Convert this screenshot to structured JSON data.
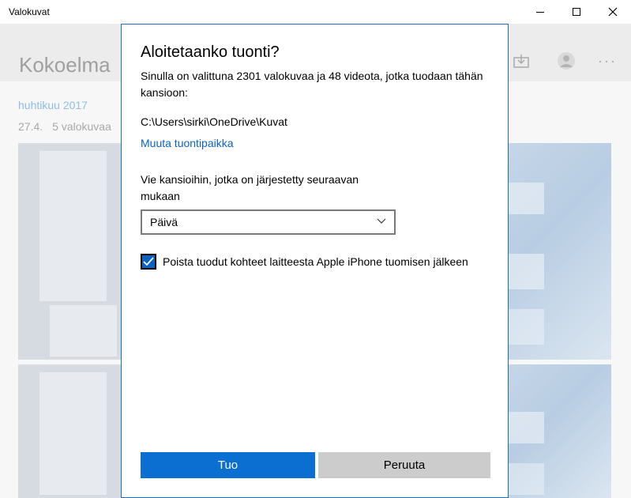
{
  "window": {
    "title": "Valokuvat",
    "controls": [
      "minimize",
      "maximize",
      "close"
    ]
  },
  "background": {
    "header_title": "Kokoelma",
    "header_icons": [
      "import-icon",
      "user-avatar",
      "more-icon"
    ],
    "month": "huhtikuu 2017",
    "date": "27.4.",
    "count": "5 valokuvaa"
  },
  "dialog": {
    "title": "Aloitetaanko tuonti?",
    "description": "Sinulla on valittuna 2301 valokuvaa ja 48 videota, jotka tuodaan tähän kansioon:",
    "path": "C:\\Users\\sirki\\OneDrive\\Kuvat",
    "change_location_link": "Muuta tuontipaikka",
    "organize_label": "Vie kansioihin, jotka on järjestetty seuraavan mukaan",
    "organize_value": "Päivä",
    "delete_checkbox_label": "Poista tuodut kohteet laitteesta Apple iPhone tuomisen jälkeen",
    "delete_checked": true,
    "import_button": "Tuo",
    "cancel_button": "Peruuta"
  },
  "colors": {
    "accent": "#0a6fd0",
    "link": "#0a63c4",
    "dialog_border": "#1a6fc8"
  }
}
